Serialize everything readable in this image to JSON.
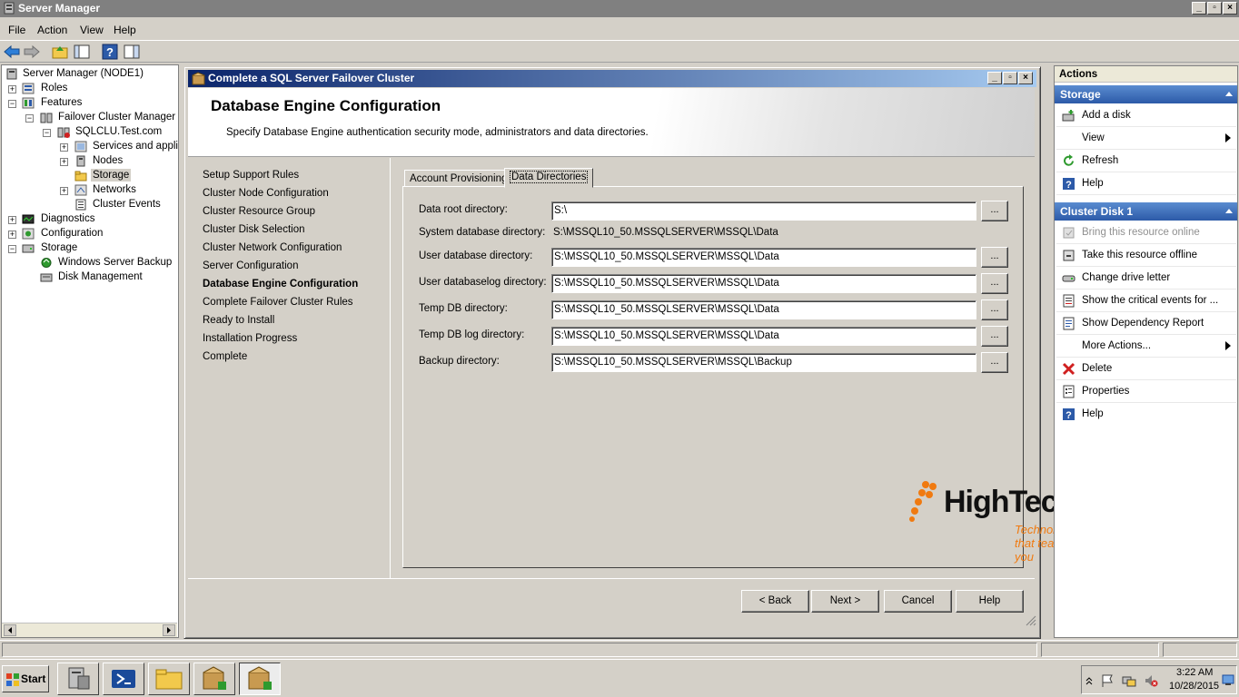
{
  "window": {
    "title": "Server Manager"
  },
  "menu": [
    "File",
    "Action",
    "View",
    "Help"
  ],
  "tree": {
    "items": [
      {
        "label": "Server Manager (NODE1)",
        "icon": "server-icon"
      },
      {
        "label": "Roles",
        "icon": "roles-icon"
      },
      {
        "label": "Features",
        "icon": "features-icon"
      },
      {
        "label": "Failover Cluster Manager",
        "icon": "cluster-icon"
      },
      {
        "label": "SQLCLU.Test.com",
        "icon": "cluster-node-icon"
      },
      {
        "label": "Services and applica",
        "icon": "services-icon"
      },
      {
        "label": "Nodes",
        "icon": "nodes-icon"
      },
      {
        "label": "Storage",
        "icon": "storage-icon"
      },
      {
        "label": "Networks",
        "icon": "networks-icon"
      },
      {
        "label": "Cluster Events",
        "icon": "events-icon"
      },
      {
        "label": "Diagnostics",
        "icon": "diagnostics-icon"
      },
      {
        "label": "Configuration",
        "icon": "configuration-icon"
      },
      {
        "label": "Storage",
        "icon": "storage-root-icon"
      },
      {
        "label": "Windows Server Backup",
        "icon": "backup-icon"
      },
      {
        "label": "Disk Management",
        "icon": "disk-icon"
      }
    ]
  },
  "dialog": {
    "title": "Complete a SQL Server Failover Cluster",
    "heading": "Database Engine Configuration",
    "description": "Specify Database Engine authentication security mode, administrators and data directories.",
    "nav": [
      "Setup Support Rules",
      "Cluster Node Configuration",
      "Cluster Resource Group",
      "Cluster Disk Selection",
      "Cluster Network Configuration",
      "Server Configuration",
      "Database Engine Configuration",
      "Complete Failover Cluster Rules",
      "Ready to Install",
      "Installation Progress",
      "Complete"
    ],
    "nav_active": "Database Engine Configuration",
    "tabs": [
      "Account Provisioning",
      "Data Directories"
    ],
    "active_tab": "Data Directories",
    "fields": {
      "data_root": {
        "label": "Data root directory:",
        "value": "S:\\"
      },
      "system_db": {
        "label": "System database directory:",
        "value": "S:\\MSSQL10_50.MSSQLSERVER\\MSSQL\\Data"
      },
      "user_db": {
        "label": "User database directory:",
        "value": "S:\\MSSQL10_50.MSSQLSERVER\\MSSQL\\Data"
      },
      "user_db_log": {
        "label": "User databaselog directory:",
        "value": "S:\\MSSQL10_50.MSSQLSERVER\\MSSQL\\Data"
      },
      "temp_db": {
        "label": "Temp DB directory:",
        "value": "S:\\MSSQL10_50.MSSQLSERVER\\MSSQL\\Data"
      },
      "temp_db_log": {
        "label": "Temp DB log directory:",
        "value": "S:\\MSSQL10_50.MSSQLSERVER\\MSSQL\\Data"
      },
      "backup": {
        "label": "Backup directory:",
        "value": "S:\\MSSQL10_50.MSSQLSERVER\\MSSQL\\Backup"
      }
    },
    "browse_label": "...",
    "buttons": {
      "back": "< Back",
      "next": "Next >",
      "cancel": "Cancel",
      "help": "Help"
    }
  },
  "watermark": {
    "brand": "HighTechnology",
    "tagline": "Technology that teach you"
  },
  "actions": {
    "header": "Actions",
    "sections": [
      {
        "title": "Storage",
        "items": [
          {
            "label": "Add a disk",
            "icon": "add-disk-icon"
          },
          {
            "label": "View",
            "icon": "",
            "submenu": true
          },
          {
            "label": "Refresh",
            "icon": "refresh-icon"
          },
          {
            "label": "Help",
            "icon": "help-icon"
          }
        ]
      },
      {
        "title": "Cluster Disk 1",
        "items": [
          {
            "label": "Bring this resource online",
            "icon": "online-icon",
            "disabled": true
          },
          {
            "label": "Take this resource offline",
            "icon": "offline-icon"
          },
          {
            "label": "Change drive letter",
            "icon": "drive-icon"
          },
          {
            "label": "Show the critical events for ...",
            "icon": "events-icon"
          },
          {
            "label": "Show Dependency Report",
            "icon": "report-icon"
          },
          {
            "label": "More Actions...",
            "icon": "",
            "submenu": true
          },
          {
            "label": "Delete",
            "icon": "delete-icon"
          },
          {
            "label": "Properties",
            "icon": "properties-icon"
          },
          {
            "label": "Help",
            "icon": "help-icon"
          }
        ]
      }
    ]
  },
  "taskbar": {
    "start": "Start",
    "time": "3:22 AM",
    "date": "10/28/2015"
  },
  "colors": {
    "accent": "#2c5aa8",
    "title_gradient_start": "#0a246a",
    "watermark_orange": "#f07a10"
  }
}
